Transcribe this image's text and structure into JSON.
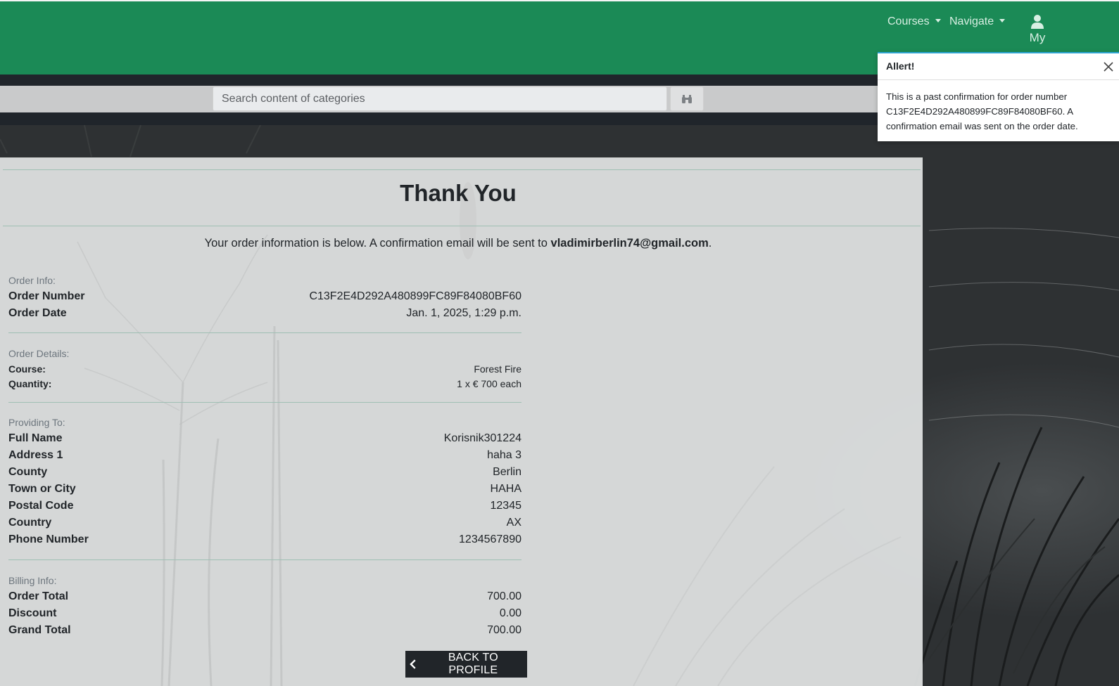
{
  "navbar": {
    "courses_label": "Courses",
    "navigate_label": "Navigate",
    "account_label": "My"
  },
  "search": {
    "placeholder": "Search content of categories"
  },
  "alert": {
    "title": "Allert!",
    "message": "This is a past confirmation for order number C13F2E4D292A480899FC89F84080BF60. A confirmation email was sent on the order date."
  },
  "page": {
    "title": "Thank You",
    "intro_text": "Your order information is below. A confirmation email will be sent to",
    "email": "vladimirberlin74@gmail.com",
    "intro_end": "."
  },
  "order_info": {
    "label": "Order Info:",
    "rows": [
      {
        "key": "Order Number",
        "value": "C13F2E4D292A480899FC89F84080BF60"
      },
      {
        "key": "Order Date",
        "value": "Jan. 1, 2025, 1:29 p.m."
      }
    ]
  },
  "order_details": {
    "label": "Order Details:",
    "rows": [
      {
        "key": "Course:",
        "value": "Forest Fire"
      },
      {
        "key": "Quantity:",
        "value": "1 x  € 700 each"
      }
    ]
  },
  "providing_to": {
    "label": "Providing To:",
    "rows": [
      {
        "key": "Full Name",
        "value": "Korisnik301224"
      },
      {
        "key": "Address 1",
        "value": "haha 3"
      },
      {
        "key": "County",
        "value": "Berlin"
      },
      {
        "key": "Town or City",
        "value": "HAHA"
      },
      {
        "key": "Postal Code",
        "value": "12345"
      },
      {
        "key": "Country",
        "value": "AX"
      },
      {
        "key": "Phone Number",
        "value": "1234567890"
      }
    ]
  },
  "billing_info": {
    "label": "Billing Info:",
    "rows": [
      {
        "key": "Order Total",
        "value": "700.00"
      },
      {
        "key": "Discount",
        "value": "0.00"
      },
      {
        "key": "Grand Total",
        "value": "700.00"
      }
    ]
  },
  "back_button_label": "BACK TO PROFILE",
  "icons": {
    "nav_caret": "caret-down-icon",
    "account": "user-icon",
    "search": "binoculars-icon",
    "close": "close-icon",
    "back": "chevron-left-icon"
  },
  "colors": {
    "navbar": "#1b8a56",
    "dark_strip": "#20252b",
    "button": "#212529",
    "alert_accent": "#2fa6d4"
  }
}
